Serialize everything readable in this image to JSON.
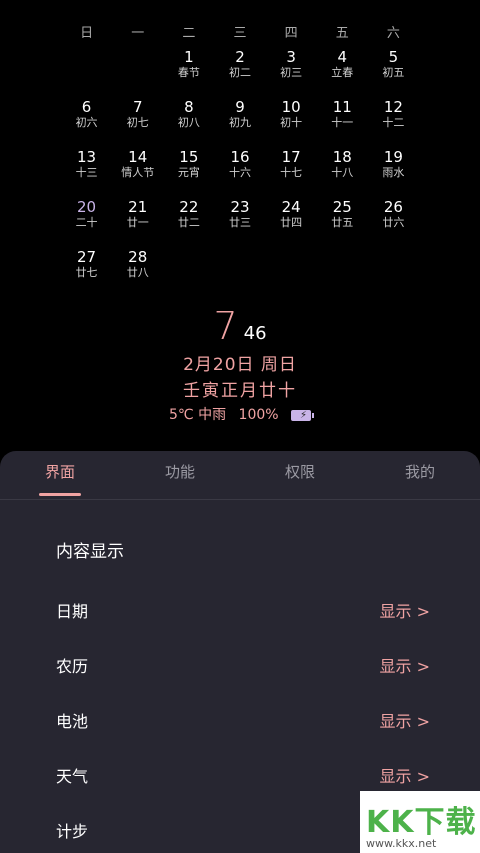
{
  "weekdays": [
    "日",
    "一",
    "二",
    "三",
    "四",
    "五",
    "六"
  ],
  "calendar": [
    {
      "num": "",
      "lunar": ""
    },
    {
      "num": "",
      "lunar": ""
    },
    {
      "num": "1",
      "lunar": "春节"
    },
    {
      "num": "2",
      "lunar": "初二"
    },
    {
      "num": "3",
      "lunar": "初三"
    },
    {
      "num": "4",
      "lunar": "立春"
    },
    {
      "num": "5",
      "lunar": "初五"
    },
    {
      "num": "6",
      "lunar": "初六"
    },
    {
      "num": "7",
      "lunar": "初七"
    },
    {
      "num": "8",
      "lunar": "初八"
    },
    {
      "num": "9",
      "lunar": "初九"
    },
    {
      "num": "10",
      "lunar": "初十"
    },
    {
      "num": "11",
      "lunar": "十一"
    },
    {
      "num": "12",
      "lunar": "十二"
    },
    {
      "num": "13",
      "lunar": "十三"
    },
    {
      "num": "14",
      "lunar": "情人节"
    },
    {
      "num": "15",
      "lunar": "元宵"
    },
    {
      "num": "16",
      "lunar": "十六"
    },
    {
      "num": "17",
      "lunar": "十七"
    },
    {
      "num": "18",
      "lunar": "十八"
    },
    {
      "num": "19",
      "lunar": "雨水"
    },
    {
      "num": "20",
      "lunar": "二十",
      "today": true
    },
    {
      "num": "21",
      "lunar": "廿一"
    },
    {
      "num": "22",
      "lunar": "廿二"
    },
    {
      "num": "23",
      "lunar": "廿三"
    },
    {
      "num": "24",
      "lunar": "廿四"
    },
    {
      "num": "25",
      "lunar": "廿五"
    },
    {
      "num": "26",
      "lunar": "廿六"
    },
    {
      "num": "27",
      "lunar": "廿七"
    },
    {
      "num": "28",
      "lunar": "廿八"
    }
  ],
  "clock": {
    "hour": "7",
    "minute": "46"
  },
  "date_line": "2月20日 周日",
  "lunar_line": "壬寅正月廿十",
  "status": {
    "weather": "5℃ 中雨",
    "battery": "100%"
  },
  "tabs": [
    {
      "label": "界面",
      "active": true
    },
    {
      "label": "功能"
    },
    {
      "label": "权限"
    },
    {
      "label": "我的"
    }
  ],
  "section_title": "内容显示",
  "rows": [
    {
      "label": "日期",
      "value": "显示 >"
    },
    {
      "label": "农历",
      "value": "显示 >"
    },
    {
      "label": "电池",
      "value": "显示 >"
    },
    {
      "label": "天气",
      "value": "显示 >"
    },
    {
      "label": "计步",
      "value": ""
    }
  ],
  "watermark": {
    "logo": "KK下载",
    "url": "www.kkx.net"
  },
  "colors": {
    "accent": "#f0a3a3",
    "panel": "#272631",
    "today": "#c9b4e8"
  }
}
